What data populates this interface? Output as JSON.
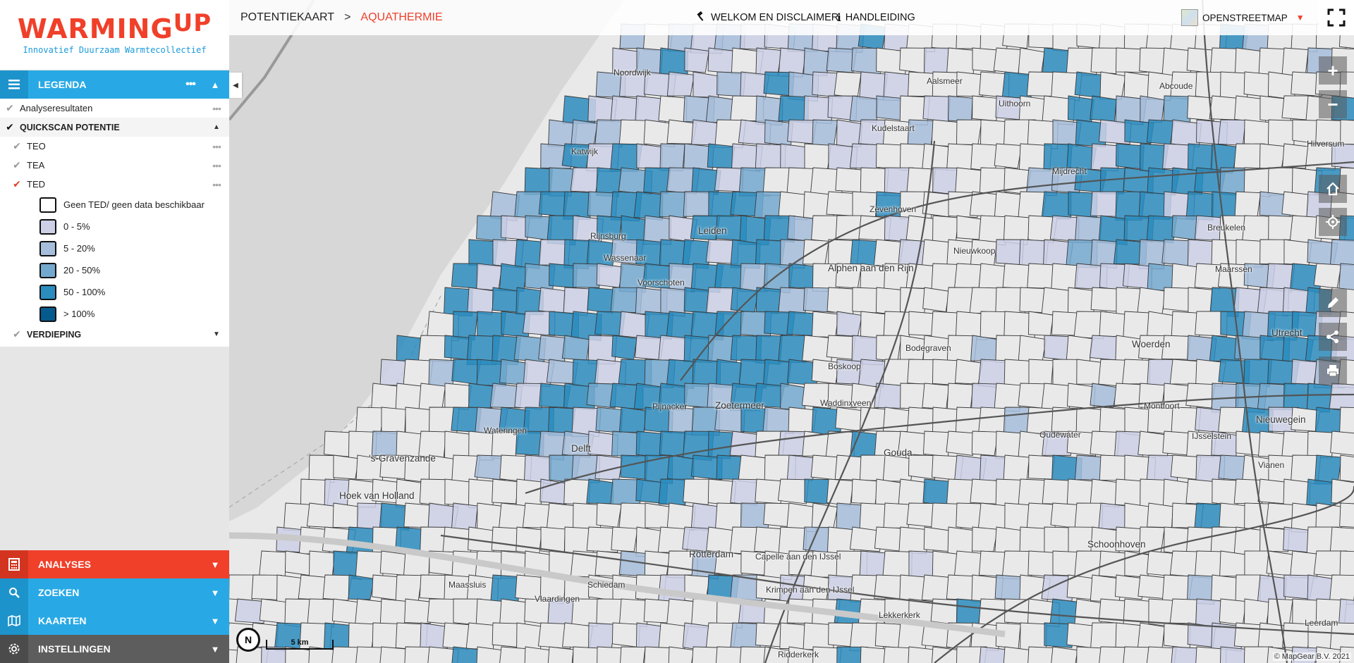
{
  "logo": {
    "main": "WARMING",
    "sup": "UP",
    "tagline": "Innovatief Duurzaam Warmtecollectief"
  },
  "legend": {
    "title": "LEGENDA",
    "more": "•••",
    "layers": [
      {
        "label": "Analyseresultaten"
      }
    ],
    "group": {
      "label": "QUICKSCAN POTENTIE"
    },
    "sublayers": [
      {
        "label": "TEO"
      },
      {
        "label": "TEA"
      },
      {
        "label": "TED"
      }
    ],
    "classes": [
      {
        "label": "Geen TED/ geen data beschikbaar",
        "color": "#ffffff"
      },
      {
        "label": "0 - 5%",
        "color": "#cdd0e6"
      },
      {
        "label": "5 - 20%",
        "color": "#a6bddb"
      },
      {
        "label": "20 - 50%",
        "color": "#74a9cf"
      },
      {
        "label": "50 - 100%",
        "color": "#2b8cbe"
      },
      {
        "label": "> 100%",
        "color": "#045a8d"
      }
    ],
    "verdieping": {
      "label": "VERDIEPING"
    }
  },
  "panels": {
    "analyses": "ANALYSES",
    "zoeken": "ZOEKEN",
    "kaarten": "KAARTEN",
    "instellingen": "INSTELLINGEN"
  },
  "topbar": {
    "crumb1": "POTENTIEKAART",
    "separator": ">",
    "crumb2": "AQUATHERMIE",
    "welkom": "WELKOM EN DISCLAIMER",
    "handleiding": "HANDLEIDING",
    "basemap": "OPENSTREETMAP"
  },
  "map": {
    "scale": "5 km",
    "north": "N",
    "attribution": "© MapGear B.V. 2021",
    "places": [
      {
        "name": "Hoek van Holland"
      },
      {
        "name": "'s-Gravenzande"
      },
      {
        "name": "Delft"
      },
      {
        "name": "Rotterdam"
      },
      {
        "name": "Zoetermeer"
      },
      {
        "name": "Leiden"
      },
      {
        "name": "Alphen aan den Rijn"
      },
      {
        "name": "Gouda"
      },
      {
        "name": "Woerden"
      },
      {
        "name": "Utrecht"
      },
      {
        "name": "Nieuwegein"
      },
      {
        "name": "Schoonhoven"
      },
      {
        "name": "Boskoop"
      },
      {
        "name": "Waddinxveen"
      },
      {
        "name": "Bodegraven"
      },
      {
        "name": "Maassluis"
      },
      {
        "name": "Schiedam"
      },
      {
        "name": "Vlaardingen"
      },
      {
        "name": "Wateringen"
      },
      {
        "name": "Pijnacker"
      },
      {
        "name": "Leerdam"
      },
      {
        "name": "Vianen"
      },
      {
        "name": "Hilversum"
      },
      {
        "name": "Aalsmeer"
      },
      {
        "name": "Mijdrecht"
      },
      {
        "name": "Maarssen"
      },
      {
        "name": "Katwijk"
      },
      {
        "name": "Noordwijk"
      },
      {
        "name": "Voorschoten"
      },
      {
        "name": "Wassenaar"
      },
      {
        "name": "Capelle aan den IJssel"
      },
      {
        "name": "Krimpen aan den IJssel"
      },
      {
        "name": "Ridderkerk"
      },
      {
        "name": "Lekkerkerk"
      },
      {
        "name": "Montfoort"
      },
      {
        "name": "IJsselstein"
      },
      {
        "name": "Oudewater"
      },
      {
        "name": "Breukelen"
      },
      {
        "name": "Nieuwkoop"
      },
      {
        "name": "Zevenhoven"
      },
      {
        "name": "Rijnsburg"
      },
      {
        "name": "Kudelstaart"
      },
      {
        "name": "Uithoorn"
      },
      {
        "name": "Abcoude"
      }
    ]
  }
}
